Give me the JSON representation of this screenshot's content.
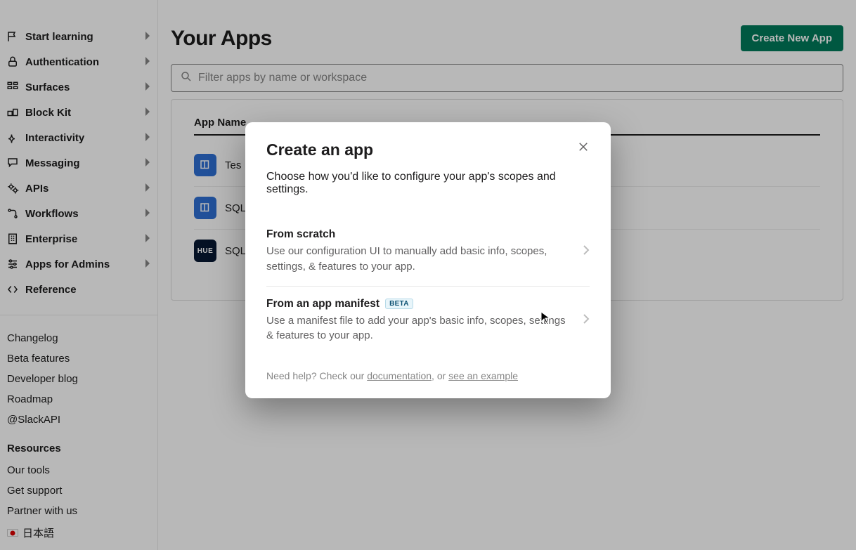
{
  "sidebar": {
    "items": [
      {
        "label": "Start learning",
        "icon": "flag-icon"
      },
      {
        "label": "Authentication",
        "icon": "lock-icon"
      },
      {
        "label": "Surfaces",
        "icon": "grid-icon"
      },
      {
        "label": "Block Kit",
        "icon": "blocks-icon"
      },
      {
        "label": "Interactivity",
        "icon": "spark-icon"
      },
      {
        "label": "Messaging",
        "icon": "chat-icon"
      },
      {
        "label": "APIs",
        "icon": "gears-icon"
      },
      {
        "label": "Workflows",
        "icon": "flow-icon"
      },
      {
        "label": "Enterprise",
        "icon": "building-icon"
      },
      {
        "label": "Apps for Admins",
        "icon": "sliders-icon"
      },
      {
        "label": "Reference",
        "icon": "code-icon"
      }
    ],
    "links": [
      "Changelog",
      "Beta features",
      "Developer blog",
      "Roadmap",
      "@SlackAPI"
    ],
    "resources_heading": "Resources",
    "resources": [
      "Our tools",
      "Get support",
      "Partner with us"
    ],
    "language": "日本語"
  },
  "header": {
    "title": "Your Apps",
    "create_label": "Create New App"
  },
  "search": {
    "placeholder": "Filter apps by name or workspace"
  },
  "table": {
    "col1": "App Name",
    "rows": [
      {
        "name": "Tes",
        "icon": "book"
      },
      {
        "name": "SQL",
        "icon": "book"
      },
      {
        "name": "SQL",
        "icon": "hue"
      }
    ]
  },
  "modal": {
    "title": "Create an app",
    "description": "Choose how you'd like to configure your app's scopes and settings.",
    "options": [
      {
        "title": "From scratch",
        "sub": "Use our configuration UI to manually add basic info, scopes, settings, & features to your app.",
        "badge": null
      },
      {
        "title": "From an app manifest",
        "sub": "Use a manifest file to add your app's basic info, scopes, settings & features to your app.",
        "badge": "BETA"
      }
    ],
    "help_prefix": "Need help? Check our ",
    "help_link1": "documentation",
    "help_mid": ", or ",
    "help_link2": "see an example"
  }
}
